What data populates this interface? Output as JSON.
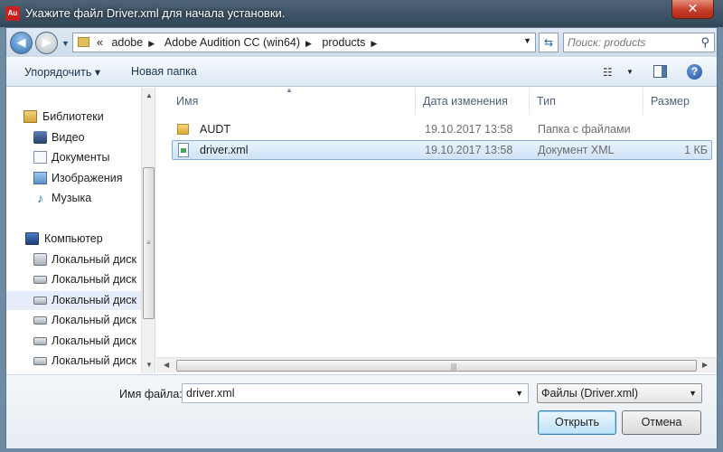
{
  "window": {
    "title": "Укажите файл Driver.xml для начала установки.",
    "close_label": "✕",
    "app_icon_text": "Au"
  },
  "address_bar": {
    "overflow": "«",
    "crumbs": [
      "adobe",
      "Adobe Audition CC (win64)",
      "products"
    ],
    "refresh_icon": "refresh-icon"
  },
  "search": {
    "placeholder": "Поиск: products"
  },
  "toolbar": {
    "organize_label": "Упорядочить ▾",
    "new_folder_label": "Новая папка"
  },
  "nav_pane": {
    "items": [
      {
        "label": "Библиотеки",
        "icon": "libraries-icon"
      },
      {
        "label": "Видео",
        "icon": "video-library-icon"
      },
      {
        "label": "Документы",
        "icon": "documents-library-icon"
      },
      {
        "label": "Изображения",
        "icon": "pictures-library-icon"
      },
      {
        "label": "Музыка",
        "icon": "music-library-icon"
      },
      {
        "label": "Компьютер",
        "icon": "computer-icon"
      },
      {
        "label": "Локальный диск",
        "icon": "system-disk-icon"
      },
      {
        "label": "Локальный диск",
        "icon": "disk-icon"
      },
      {
        "label": "Локальный диск",
        "icon": "disk-icon"
      },
      {
        "label": "Локальный диск",
        "icon": "disk-icon"
      },
      {
        "label": "Локальный диск",
        "icon": "disk-icon"
      },
      {
        "label": "Локальный диск",
        "icon": "disk-icon"
      }
    ]
  },
  "file_list": {
    "columns": [
      "Имя",
      "Дата изменения",
      "Тип",
      "Размер"
    ],
    "rows": [
      {
        "name": "AUDT",
        "date": "19.10.2017 13:58",
        "type": "Папка с файлами",
        "size": "",
        "icon": "folder-icon"
      },
      {
        "name": "driver.xml",
        "date": "19.10.2017 13:58",
        "type": "Документ XML",
        "size": "1 КБ",
        "icon": "xml-file-icon",
        "selected": true
      }
    ]
  },
  "bottom": {
    "filename_label": "Имя файла:",
    "filename_value": "driver.xml",
    "filter_value": "Файлы (Driver.xml)",
    "open_label": "Открыть",
    "cancel_label": "Отмена"
  },
  "colors": {
    "selection_border": "#84acdd",
    "selection_fill": "#cfe3f8",
    "titlebar": "#3b5063",
    "close_button": "#c7402a"
  }
}
